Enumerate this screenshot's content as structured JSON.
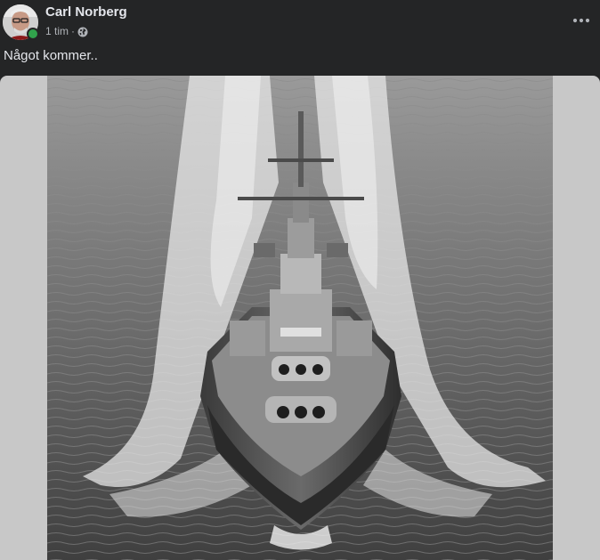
{
  "post": {
    "author": "Carl Norberg",
    "time": "1 tim",
    "separator": "·",
    "privacy_icon": "globe-icon",
    "more_icon": "more-options-icon",
    "text": "Något kommer..",
    "status": "online"
  },
  "colors": {
    "background": "#242526",
    "text_primary": "#e4e6eb",
    "text_secondary": "#b0b3b8",
    "online": "#31a24c",
    "media_backdrop": "#c8c8c8"
  }
}
